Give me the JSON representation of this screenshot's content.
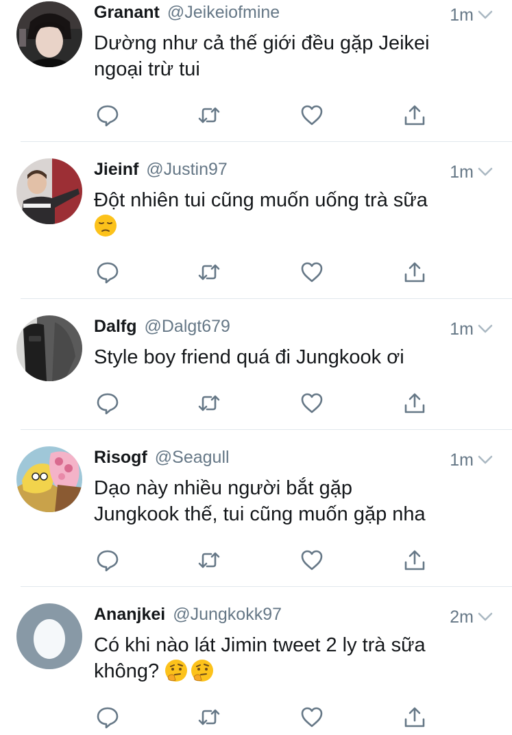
{
  "tweets": [
    {
      "name": "Granant",
      "handle": "@Jeikeiofmine",
      "time": "1m",
      "text": "Dường như cả thế giới đều gặp Jeikei\nngoại trừ tui",
      "emoji": [],
      "avatar": "avatar-photo-boy"
    },
    {
      "name": "Jieinf",
      "handle": "@Justin97",
      "time": "1m",
      "text": "Đột nhiên tui cũng muốn uống trà sữa",
      "emoji": [
        "pensive-face"
      ],
      "avatar": "avatar-photo-pointing"
    },
    {
      "name": "Dalfg",
      "handle": "@Dalgt679",
      "time": "1m",
      "text": "Style boy friend quá đi Jungkook ơi",
      "emoji": [],
      "avatar": "avatar-photo-backpack"
    },
    {
      "name": "Risogf",
      "handle": "@Seagull",
      "time": "1m",
      "text": "Dạo này nhiều người bắt gặp\nJungkook thế, tui cũng muốn gặp nha",
      "emoji": [],
      "avatar": "avatar-cartoon-flowers"
    },
    {
      "name": "Ananjkei",
      "handle": "@Jungkokk97",
      "time": "2m",
      "text": "Có khi nào lát Jimin tweet 2 ly trà sữa\nkhông? ",
      "emoji": [
        "thinking-face",
        "thinking-face"
      ],
      "avatar": "default-egg-avatar"
    }
  ],
  "colors": {
    "primary_text": "#14171a",
    "secondary_text": "#657786",
    "divider": "#e1e8ed",
    "egg_avatar_bg": "#8899a6"
  },
  "icons": [
    "reply-icon",
    "retweet-icon",
    "like-icon",
    "share-icon",
    "chevron-down-icon"
  ]
}
